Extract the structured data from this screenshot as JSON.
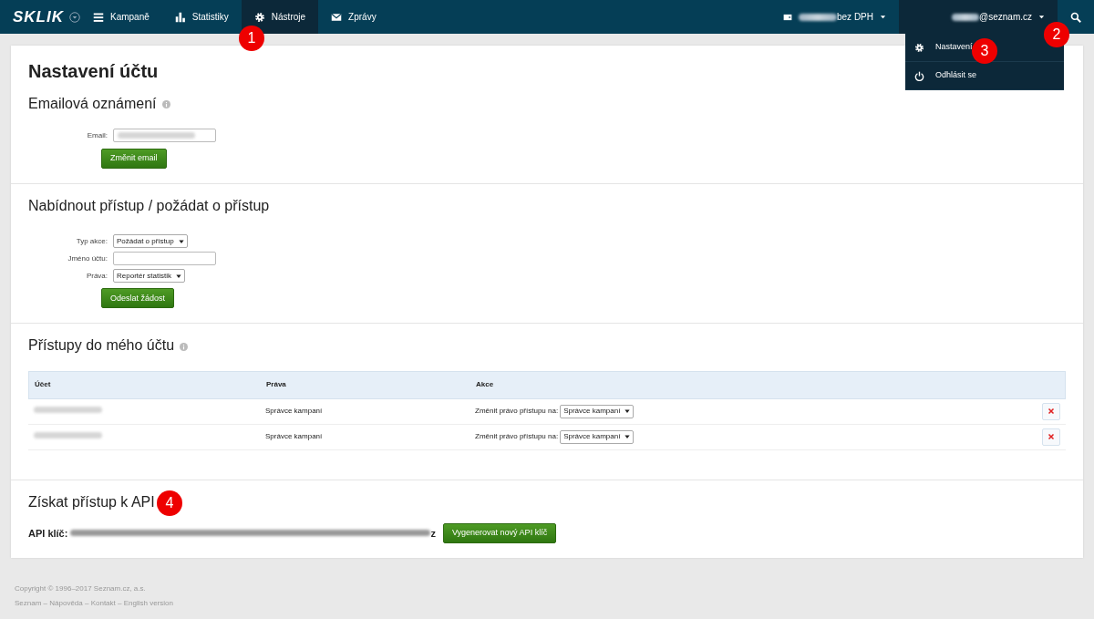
{
  "navbar": {
    "logo": "SKLIK",
    "items": [
      {
        "label": "Kampaně",
        "selected": false
      },
      {
        "label": "Statistiky",
        "selected": false
      },
      {
        "label": "Nástroje",
        "selected": true
      },
      {
        "label": "Zprávy",
        "selected": false
      }
    ],
    "credit": "bez DPH",
    "account": "@seznam.cz",
    "account_open": true
  },
  "account_menu": [
    {
      "label": "Nastavení"
    },
    {
      "label": "Odhlásit se"
    }
  ],
  "title": "Nastavení účtu",
  "email_section": {
    "heading": "Emailová oznámení",
    "email_label": "Email:",
    "button": "Změnit email"
  },
  "access_section": {
    "heading": "Nabídnout přístup / požádat o přístup",
    "fields": [
      {
        "kind": "select",
        "label": "Typ akce:",
        "value": "Požádat o přístup"
      },
      {
        "kind": "text",
        "label": "Jméno účtu:"
      },
      {
        "kind": "select",
        "label": "Práva:",
        "value": "Reportér statistik"
      }
    ],
    "button": "Odeslat žádost"
  },
  "accounts_section": {
    "heading": "Přístupy do mého účtu",
    "columns": [
      "Účet",
      "Práva",
      "Akce"
    ],
    "rows": [
      {
        "rights": "Správce kampaní",
        "action_label": "Změnit právo přístupu na:",
        "action_value": "Správce kampaní"
      },
      {
        "rights": "Správce kampaní",
        "action_label": "Změnit právo přístupu na:",
        "action_value": "Správce kampaní"
      }
    ]
  },
  "api_section": {
    "heading": "Získat přístup k API",
    "key_label": "API klíč:",
    "key_tail": "z",
    "button": "Vygenerovat nový API klíč"
  },
  "footer": {
    "copyright": "Copyright © 1996–2017 Seznam.cz, a.s.",
    "links": [
      "Seznam",
      "Nápověda",
      "Kontakt",
      "English version"
    ],
    "separator": "–"
  },
  "callouts": [
    {
      "label": "1"
    },
    {
      "label": "2"
    },
    {
      "label": "3"
    },
    {
      "label": "4"
    }
  ]
}
